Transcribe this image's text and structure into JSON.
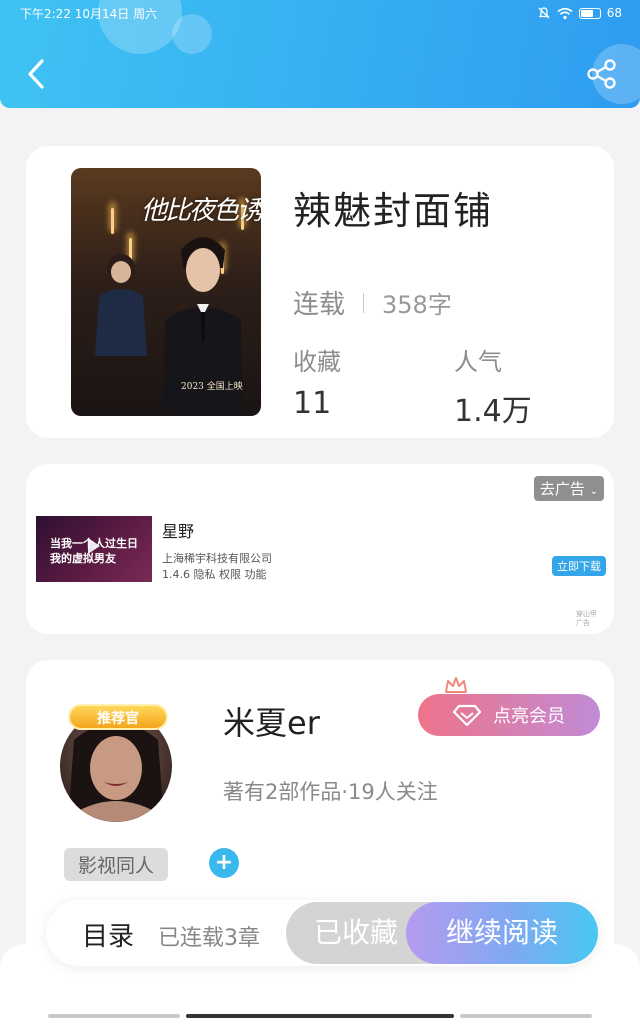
{
  "status_bar": {
    "time": "下午2:22 10月14日 周六",
    "battery": "68"
  },
  "header": {
    "back_icon": "chevron-left-icon",
    "share_icon": "share-icon"
  },
  "book": {
    "title": "辣魅封面铺",
    "status": "连载",
    "words": "358字",
    "favorites_label": "收藏",
    "favorites_value": "11",
    "popularity_label": "人气",
    "popularity_value": "1.4万",
    "cover_title": "他比夜色诱",
    "cover_date": "2023 全国上映"
  },
  "ad": {
    "remove_label": "去广告",
    "app_name": "星野",
    "company": "上海稀宇科技有限公司",
    "meta": "1.4.6  隐私  权限  功能",
    "download_label": "立即下载",
    "ad_tag": "穿山甲广告",
    "thumb_text_line1": "当我一个人过生日",
    "thumb_text_line2": "我的虚拟男友"
  },
  "author": {
    "badge": "推荐官",
    "name": "米夏er",
    "vip_label": "点亮会员",
    "info": "著有2部作品·19人关注",
    "tag": "影视同人",
    "add_tag": "+"
  },
  "bottom_bar": {
    "toc_label": "目录",
    "chapters": "已连载3章",
    "favorited_label": "已收藏",
    "continue_label": "继续阅读"
  },
  "colors": {
    "header_start": "#3fc3f3",
    "header_end": "#2f9cf0",
    "vip_start": "#ee7389",
    "vip_end": "#c18bd6",
    "read_start": "#b59bf0",
    "read_end": "#48c8f2",
    "accent_blue": "#39b8ee"
  }
}
